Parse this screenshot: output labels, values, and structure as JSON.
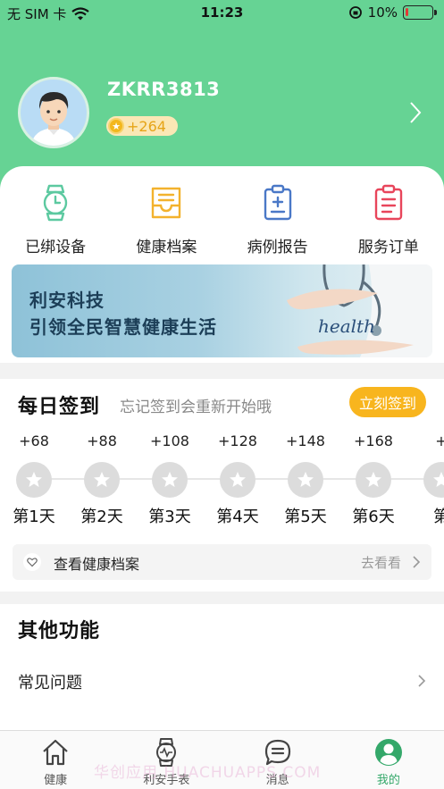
{
  "status_bar": {
    "carrier": "无 SIM 卡",
    "time": "11:23",
    "battery_percent": "10%",
    "battery_level": 0.1,
    "icons": [
      "wifi-icon",
      "rotation-lock-icon",
      "battery-icon"
    ]
  },
  "profile": {
    "username": "ZKRR3813",
    "points": "+264",
    "coin_icon": "star-coin-icon",
    "avatar_icon": "avatar-man-icon"
  },
  "quick_access": [
    {
      "label": "已绑设备",
      "icon": "watch-icon",
      "color": "#5cc9a0"
    },
    {
      "label": "健康档案",
      "icon": "inbox-tray-icon",
      "color": "#f3b22d"
    },
    {
      "label": "病例报告",
      "icon": "clipboard-plus-icon",
      "color": "#4a78c7"
    },
    {
      "label": "服务订单",
      "icon": "clipboard-list-icon",
      "color": "#e8455b"
    }
  ],
  "banner": {
    "line1": "利安科技",
    "line2": "引领全民智慧健康生活",
    "art_word": "health"
  },
  "signin": {
    "title": "每日签到",
    "subtitle": "忘记签到会重新开始哦",
    "button": "立刻签到",
    "days": [
      {
        "points": "+68",
        "label": "第1天"
      },
      {
        "points": "+88",
        "label": "第2天"
      },
      {
        "points": "+108",
        "label": "第3天"
      },
      {
        "points": "+128",
        "label": "第4天"
      },
      {
        "points": "+148",
        "label": "第5天"
      },
      {
        "points": "+168",
        "label": "第6天"
      },
      {
        "points": "+",
        "label": "第"
      }
    ],
    "health_record_link": "查看健康档案",
    "health_record_action": "去看看"
  },
  "other": {
    "title": "其他功能",
    "faq": "常见问题"
  },
  "tabbar": [
    {
      "label": "健康",
      "icon": "house-icon",
      "active": false
    },
    {
      "label": "利安手表",
      "icon": "watch-icon",
      "active": false
    },
    {
      "label": "消息",
      "icon": "chat-bubble-icon",
      "active": false
    },
    {
      "label": "我的",
      "icon": "person-icon",
      "active": true
    }
  ],
  "watermark": "华创应用 HUACHUAPPS.COM",
  "colors": {
    "header_green": "#66d394",
    "accent_yellow": "#f8b51e",
    "active_tab": "#34a86a"
  }
}
